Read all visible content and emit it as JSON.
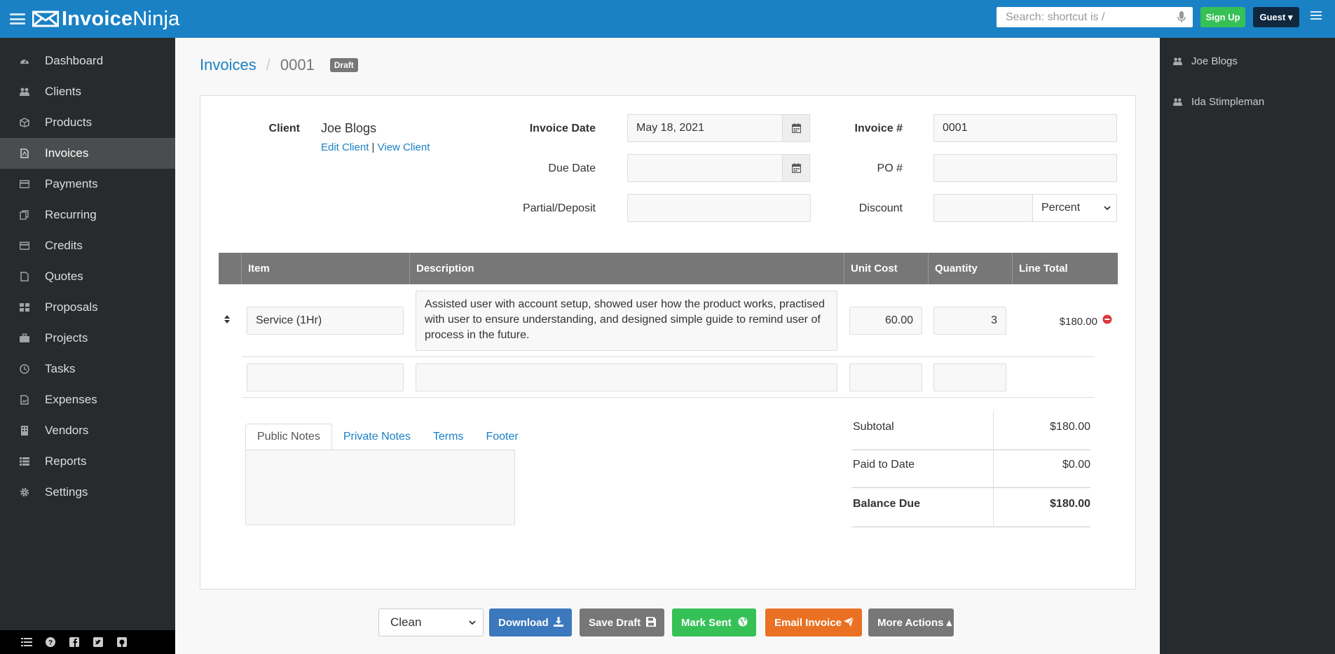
{
  "app": {
    "brand_invoice": "Invoice",
    "brand_ninja": "Ninja"
  },
  "topbar": {
    "search_placeholder": "Search: shortcut is /",
    "signup_label": "Sign Up",
    "guest_label": "Guest ▾"
  },
  "sidebar": {
    "items": [
      {
        "label": "Dashboard",
        "icon": "dashboard-icon"
      },
      {
        "label": "Clients",
        "icon": "users-icon"
      },
      {
        "label": "Products",
        "icon": "cube-icon"
      },
      {
        "label": "Invoices",
        "icon": "file-pdf-icon",
        "active": true
      },
      {
        "label": "Payments",
        "icon": "credit-card-icon"
      },
      {
        "label": "Recurring",
        "icon": "files-icon"
      },
      {
        "label": "Credits",
        "icon": "credit-card-icon"
      },
      {
        "label": "Quotes",
        "icon": "file-icon"
      },
      {
        "label": "Proposals",
        "icon": "th-large-icon"
      },
      {
        "label": "Projects",
        "icon": "briefcase-icon"
      },
      {
        "label": "Tasks",
        "icon": "clock-icon"
      },
      {
        "label": "Expenses",
        "icon": "image-file-icon"
      },
      {
        "label": "Vendors",
        "icon": "building-icon"
      },
      {
        "label": "Reports",
        "icon": "list-icon"
      },
      {
        "label": "Settings",
        "icon": "cog-icon"
      }
    ]
  },
  "right_panel": {
    "items": [
      {
        "label": "Joe Blogs",
        "icon": "users-icon"
      },
      {
        "label": "Ida Stimpleman",
        "icon": "users-icon"
      }
    ]
  },
  "breadcrumb": {
    "section": "Invoices",
    "number": "0001",
    "status": "Draft"
  },
  "form": {
    "client_label": "Client",
    "client_name": "Joe Blogs",
    "edit_client": "Edit Client",
    "separator": "|",
    "view_client": "View Client",
    "invoice_date_label": "Invoice Date",
    "invoice_date_value": "May 18, 2021",
    "due_date_label": "Due Date",
    "due_date_value": "",
    "partial_label": "Partial/Deposit",
    "partial_value": "",
    "invoice_num_label": "Invoice #",
    "invoice_num_value": "0001",
    "po_label": "PO #",
    "po_value": "",
    "discount_label": "Discount",
    "discount_value": "",
    "discount_type": "Percent"
  },
  "items_table": {
    "columns": [
      "Item",
      "Description",
      "Unit Cost",
      "Quantity",
      "Line Total"
    ],
    "rows": [
      {
        "item": "Service (1Hr)",
        "description": "Assisted user with account setup, showed user how the product works, practised with user to ensure understanding, and designed simple guide to remind user of process in the future.",
        "unit_cost": "60.00",
        "quantity": "3",
        "line_total": "$180.00"
      }
    ]
  },
  "notes_tabs": [
    "Public Notes",
    "Private Notes",
    "Terms",
    "Footer"
  ],
  "totals": {
    "subtotal_label": "Subtotal",
    "subtotal_value": "$180.00",
    "paid_label": "Paid to Date",
    "paid_value": "$0.00",
    "balance_label": "Balance Due",
    "balance_value": "$180.00"
  },
  "actions": {
    "design_select": "Clean",
    "download": "Download",
    "save_draft": "Save Draft",
    "mark_sent": "Mark Sent",
    "email_invoice": "Email Invoice",
    "more_actions": "More Actions ▴"
  },
  "colors": {
    "topbar": "#1a81c5",
    "sidebar": "#272b2e",
    "download": "#3c78bd",
    "save_draft": "#777777",
    "mark_sent": "#36c157",
    "email_invoice": "#ea7124",
    "more_actions": "#777777"
  }
}
